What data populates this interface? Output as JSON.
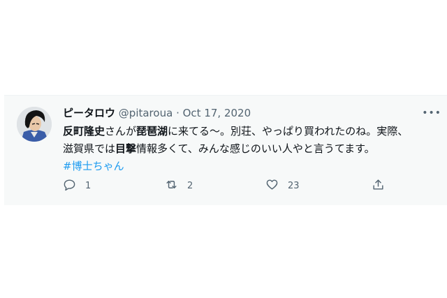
{
  "tweet": {
    "display_name": "ピータロウ",
    "handle": "@pitaroua",
    "separator": "·",
    "date": "Oct 17, 2020",
    "more_label": "•••",
    "body": {
      "line1": {
        "s1": "反町隆史",
        "s2": "さんが",
        "s3": "琵琶湖",
        "s4": "に来てる〜。別荘、やっぱり買われたのね。実際、"
      },
      "line2": {
        "s1": "滋賀県では",
        "s2": "目撃",
        "s3": "情報多くて、みんな感じのいい人やと言うてます。"
      },
      "hashtag": "#博士ちゃん"
    },
    "actions": {
      "reply_count": "1",
      "retweet_count": "2",
      "like_count": "23"
    }
  },
  "icons": {
    "reply": "speech-bubble",
    "retweet": "two-arrows-loop",
    "like": "heart-outline",
    "share": "upload-arrow"
  },
  "colors": {
    "card_background": "#f7f9f9",
    "text": "#0f1419",
    "muted": "#536471",
    "hashtag": "#1d9bf0"
  }
}
